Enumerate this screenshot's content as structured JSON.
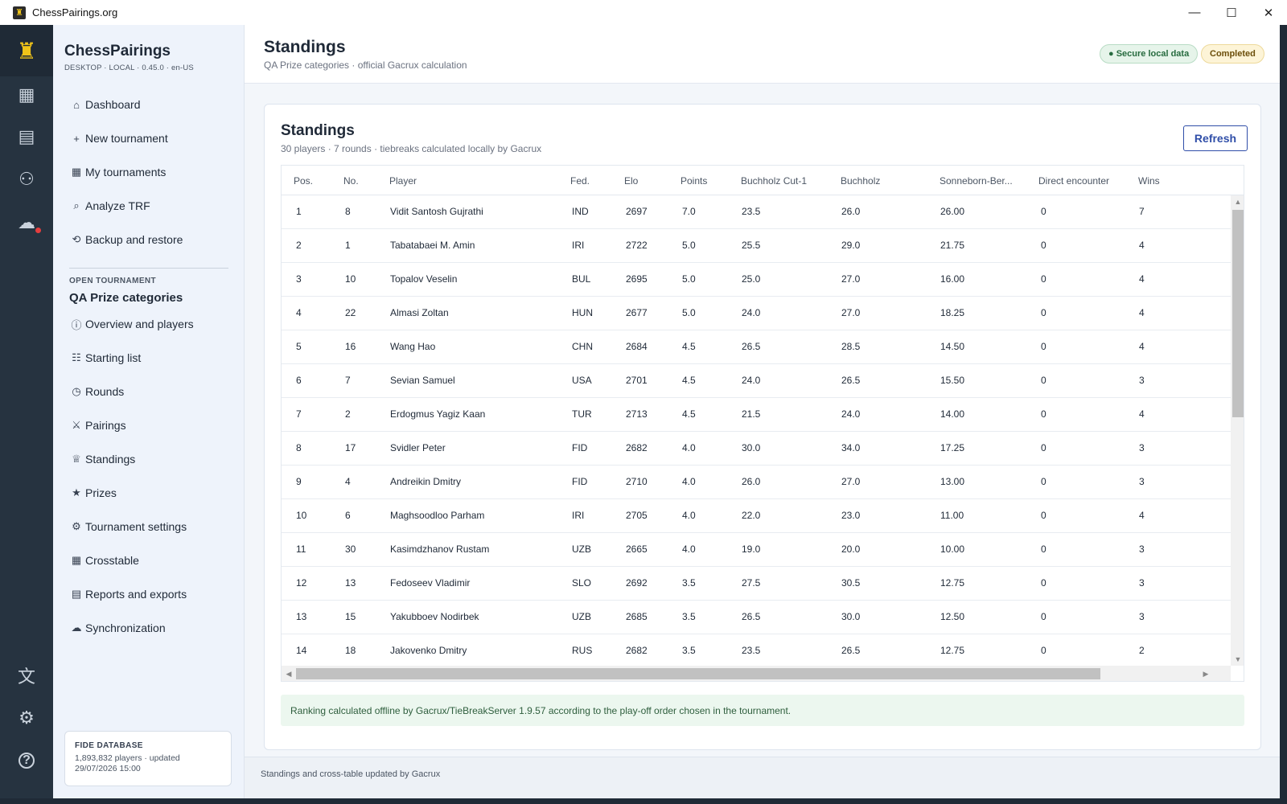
{
  "window": {
    "title": "ChessPairings.org",
    "minimize": "—",
    "maximize": "☐",
    "close": "✕"
  },
  "rail": {
    "logo_icon": "rook-icon",
    "items": [
      {
        "icon": "dashboard-icon",
        "glyph": "▦"
      },
      {
        "icon": "calendar-icon",
        "glyph": "▤"
      },
      {
        "icon": "people-icon",
        "glyph": "⚇"
      },
      {
        "icon": "cloud-alert-icon",
        "glyph": "☁"
      }
    ],
    "bottom": [
      {
        "icon": "translate-icon",
        "glyph": "文"
      },
      {
        "icon": "gear-icon",
        "glyph": "⚙"
      },
      {
        "icon": "help-icon",
        "glyph": "?"
      }
    ]
  },
  "sidebar": {
    "brand": "ChessPairings",
    "brand_meta": "DESKTOP · LOCAL · 0.45.0 · en-US",
    "main_nav": [
      {
        "icon": "⌂",
        "label": "Dashboard"
      },
      {
        "icon": "+",
        "label": "New tournament"
      },
      {
        "icon": "▦",
        "label": "My tournaments"
      },
      {
        "icon": "⌕",
        "label": "Analyze TRF"
      },
      {
        "icon": "⟲",
        "label": "Backup and restore"
      }
    ],
    "open_label": "OPEN TOURNAMENT",
    "open_name": "QA Prize categories",
    "tournament_nav": [
      {
        "icon": "ⓘ",
        "label": "Overview and players"
      },
      {
        "icon": "☷",
        "label": "Starting list"
      },
      {
        "icon": "◷",
        "label": "Rounds"
      },
      {
        "icon": "⚔",
        "label": "Pairings"
      },
      {
        "icon": "♕",
        "label": "Standings"
      },
      {
        "icon": "★",
        "label": "Prizes"
      },
      {
        "icon": "⚙",
        "label": "Tournament settings"
      },
      {
        "icon": "▦",
        "label": "Crosstable"
      },
      {
        "icon": "▤",
        "label": "Reports and exports"
      },
      {
        "icon": "☁",
        "label": "Synchronization"
      }
    ],
    "fide": {
      "title": "FIDE DATABASE",
      "line1": "1,893,832 players · updated",
      "line2": "29/07/2026 15:00"
    }
  },
  "header": {
    "title": "Standings",
    "subtitle": "QA Prize categories · official Gacrux calculation",
    "badge_secure": "● Secure local data",
    "badge_completed": "Completed"
  },
  "card": {
    "title": "Standings",
    "subtitle": "30 players · 7 rounds · tiebreaks calculated locally by Gacrux",
    "refresh": "Refresh",
    "note": "Ranking calculated offline by Gacrux/TieBreakServer 1.9.57 according to the play-off order chosen in the tournament."
  },
  "table": {
    "columns": [
      "Pos.",
      "No.",
      "Player",
      "Fed.",
      "Elo",
      "Points",
      "Buchholz Cut-1",
      "Buchholz",
      "Sonneborn-Ber...",
      "Direct encounter",
      "Wins"
    ],
    "rows": [
      [
        "1",
        "8",
        "Vidit Santosh Gujrathi",
        "IND",
        "2697",
        "7.0",
        "23.5",
        "26.0",
        "26.00",
        "0",
        "7"
      ],
      [
        "2",
        "1",
        "Tabatabaei M. Amin",
        "IRI",
        "2722",
        "5.0",
        "25.5",
        "29.0",
        "21.75",
        "0",
        "4"
      ],
      [
        "3",
        "10",
        "Topalov Veselin",
        "BUL",
        "2695",
        "5.0",
        "25.0",
        "27.0",
        "16.00",
        "0",
        "4"
      ],
      [
        "4",
        "22",
        "Almasi Zoltan",
        "HUN",
        "2677",
        "5.0",
        "24.0",
        "27.0",
        "18.25",
        "0",
        "4"
      ],
      [
        "5",
        "16",
        "Wang Hao",
        "CHN",
        "2684",
        "4.5",
        "26.5",
        "28.5",
        "14.50",
        "0",
        "4"
      ],
      [
        "6",
        "7",
        "Sevian Samuel",
        "USA",
        "2701",
        "4.5",
        "24.0",
        "26.5",
        "15.50",
        "0",
        "3"
      ],
      [
        "7",
        "2",
        "Erdogmus Yagiz Kaan",
        "TUR",
        "2713",
        "4.5",
        "21.5",
        "24.0",
        "14.00",
        "0",
        "4"
      ],
      [
        "8",
        "17",
        "Svidler Peter",
        "FID",
        "2682",
        "4.0",
        "30.0",
        "34.0",
        "17.25",
        "0",
        "3"
      ],
      [
        "9",
        "4",
        "Andreikin Dmitry",
        "FID",
        "2710",
        "4.0",
        "26.0",
        "27.0",
        "13.00",
        "0",
        "3"
      ],
      [
        "10",
        "6",
        "Maghsoodloo Parham",
        "IRI",
        "2705",
        "4.0",
        "22.0",
        "23.0",
        "11.00",
        "0",
        "4"
      ],
      [
        "11",
        "30",
        "Kasimdzhanov Rustam",
        "UZB",
        "2665",
        "4.0",
        "19.0",
        "20.0",
        "10.00",
        "0",
        "3"
      ],
      [
        "12",
        "13",
        "Fedoseev Vladimir",
        "SLO",
        "2692",
        "3.5",
        "27.5",
        "30.5",
        "12.75",
        "0",
        "3"
      ],
      [
        "13",
        "15",
        "Yakubboev Nodirbek",
        "UZB",
        "2685",
        "3.5",
        "26.5",
        "30.0",
        "12.50",
        "0",
        "3"
      ],
      [
        "14",
        "18",
        "Jakovenko Dmitry",
        "RUS",
        "2682",
        "3.5",
        "23.5",
        "26.5",
        "12.75",
        "0",
        "2"
      ]
    ]
  },
  "footer": {
    "text": "Standings and cross-table updated by Gacrux"
  }
}
